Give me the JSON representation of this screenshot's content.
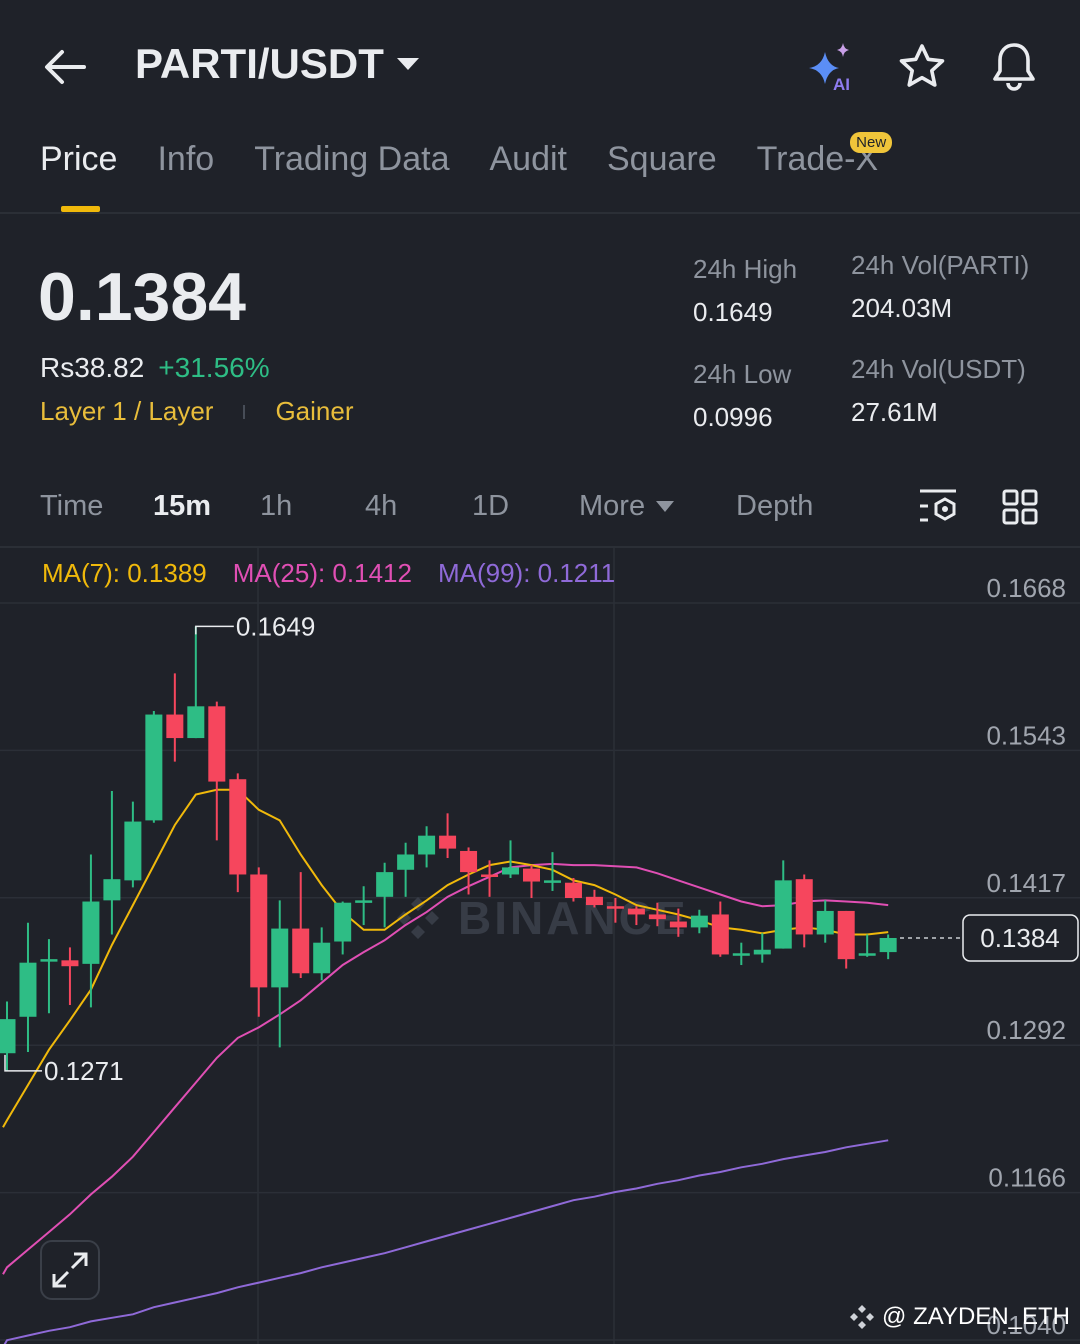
{
  "header": {
    "title": "PARTI/USDT",
    "icons": [
      "back-arrow-icon",
      "caret-down-icon",
      "ai-sparkle-icon",
      "star-icon",
      "bell-icon"
    ],
    "ai_label": "AI"
  },
  "tabs": [
    {
      "label": "Price",
      "active": true
    },
    {
      "label": "Info"
    },
    {
      "label": "Trading Data"
    },
    {
      "label": "Audit"
    },
    {
      "label": "Square"
    },
    {
      "label": "Trade-X",
      "badge": "New"
    }
  ],
  "ticker": {
    "price": "0.1384",
    "fiat": "Rs38.82",
    "change": "+31.56%",
    "tag1": "Layer 1 / Layer",
    "tag2": "Gainer"
  },
  "stats": {
    "high_label": "24h High",
    "high": "0.1649",
    "low_label": "24h Low",
    "low": "0.0996",
    "vol_base_label": "24h Vol(PARTI)",
    "vol_base": "204.03M",
    "vol_quote_label": "24h Vol(USDT)",
    "vol_quote": "27.61M"
  },
  "timeframes": {
    "time": "Time",
    "m15": "15m",
    "h1": "1h",
    "h4": "4h",
    "d1": "1D",
    "more": "More",
    "depth": "Depth",
    "selected": "15m"
  },
  "ma_legend": {
    "ma7": "MA(7): 0.1389",
    "ma25": "MA(25): 0.1412",
    "ma99": "MA(99): 0.1211"
  },
  "watermark": {
    "chart": "BINANCE",
    "user": "@ ZAYDEN_ETH"
  },
  "colors": {
    "up": "#2ebd85",
    "down": "#f6465d",
    "ma7": "#f0b90b",
    "ma25": "#e04fb4",
    "ma99": "#8f6ad8",
    "accent": "#f0b90b"
  },
  "chart_data": {
    "type": "candlestick",
    "interval": "15m",
    "y_ticks": [
      "0.1668",
      "0.1543",
      "0.1417",
      "0.1292",
      "0.1166",
      "0.1040"
    ],
    "ylim": [
      0.104,
      0.1668
    ],
    "high_marker": "0.1649",
    "low_marker": "0.1271",
    "last_price": "0.1384",
    "grid": true,
    "candles": [
      [
        0.1286,
        0.133,
        0.1271,
        0.1315
      ],
      [
        0.1317,
        0.1397,
        0.1287,
        0.1363
      ],
      [
        0.1364,
        0.1383,
        0.132,
        0.1366
      ],
      [
        0.1365,
        0.1376,
        0.1327,
        0.136
      ],
      [
        0.1362,
        0.1455,
        0.1325,
        0.1415
      ],
      [
        0.1416,
        0.1509,
        0.1387,
        0.1434
      ],
      [
        0.1433,
        0.15,
        0.1427,
        0.1483
      ],
      [
        0.1484,
        0.1577,
        0.1482,
        0.1574
      ],
      [
        0.1574,
        0.1609,
        0.1534,
        0.1554
      ],
      [
        0.1554,
        0.1649,
        0.1554,
        0.1581
      ],
      [
        0.1581,
        0.1585,
        0.1467,
        0.1517
      ],
      [
        0.1519,
        0.1524,
        0.1423,
        0.1438
      ],
      [
        0.1438,
        0.1444,
        0.1317,
        0.1342
      ],
      [
        0.1342,
        0.1416,
        0.1291,
        0.1392
      ],
      [
        0.1392,
        0.144,
        0.135,
        0.1354
      ],
      [
        0.1354,
        0.1393,
        0.1348,
        0.138
      ],
      [
        0.1381,
        0.1415,
        0.137,
        0.1414
      ],
      [
        0.1414,
        0.1428,
        0.1395,
        0.1416
      ],
      [
        0.1419,
        0.1448,
        0.1393,
        0.144
      ],
      [
        0.1442,
        0.1465,
        0.1419,
        0.1455
      ],
      [
        0.1455,
        0.1479,
        0.1444,
        0.1471
      ],
      [
        0.1471,
        0.149,
        0.1452,
        0.146
      ],
      [
        0.1458,
        0.1461,
        0.1421,
        0.144
      ],
      [
        0.1438,
        0.145,
        0.1419,
        0.1437
      ],
      [
        0.1438,
        0.1467,
        0.1435,
        0.1444
      ],
      [
        0.1443,
        0.1446,
        0.1418,
        0.1432
      ],
      [
        0.1432,
        0.1457,
        0.1424,
        0.1433
      ],
      [
        0.1431,
        0.1435,
        0.1415,
        0.1418
      ],
      [
        0.1419,
        0.1425,
        0.141,
        0.1412
      ],
      [
        0.1411,
        0.1418,
        0.1397,
        0.141
      ],
      [
        0.1409,
        0.1411,
        0.1395,
        0.1404
      ],
      [
        0.1404,
        0.1414,
        0.1394,
        0.14
      ],
      [
        0.1398,
        0.1409,
        0.1385,
        0.1393
      ],
      [
        0.1393,
        0.1408,
        0.1388,
        0.1403
      ],
      [
        0.1404,
        0.1415,
        0.1368,
        0.137
      ],
      [
        0.137,
        0.138,
        0.1361,
        0.1371
      ],
      [
        0.137,
        0.1388,
        0.1363,
        0.1374
      ],
      [
        0.1375,
        0.145,
        0.1375,
        0.1433
      ],
      [
        0.1434,
        0.1438,
        0.1376,
        0.1387
      ],
      [
        0.1387,
        0.1416,
        0.138,
        0.1407
      ],
      [
        0.1407,
        0.1407,
        0.1358,
        0.1366
      ],
      [
        0.137,
        0.1387,
        0.1368,
        0.1371
      ],
      [
        0.1372,
        0.1387,
        0.1366,
        0.1384
      ]
    ],
    "candle_format": [
      "open",
      "high",
      "low",
      "close"
    ],
    "ma7": [
      0.1229,
      0.1259,
      0.1289,
      0.1314,
      0.134,
      0.1378,
      0.1412,
      0.1446,
      0.148,
      0.1506,
      0.151,
      0.151,
      0.1493,
      0.1484,
      0.1455,
      0.1429,
      0.1406,
      0.1391,
      0.1391,
      0.1404,
      0.1416,
      0.1429,
      0.1438,
      0.1446,
      0.1449,
      0.1446,
      0.1442,
      0.1433,
      0.1429,
      0.1421,
      0.1412,
      0.1408,
      0.1404,
      0.1399,
      0.1393,
      0.1391,
      0.1388,
      0.1391,
      0.1393,
      0.1391,
      0.1387,
      0.1387,
      0.1389
    ],
    "ma25": [
      0.1104,
      0.1119,
      0.1134,
      0.1149,
      0.1166,
      0.1181,
      0.1198,
      0.1219,
      0.124,
      0.1261,
      0.1282,
      0.1299,
      0.1308,
      0.1319,
      0.1331,
      0.1346,
      0.1361,
      0.1372,
      0.1382,
      0.1395,
      0.1406,
      0.1419,
      0.1428,
      0.1436,
      0.1444,
      0.1446,
      0.1447,
      0.1446,
      0.1446,
      0.1445,
      0.1444,
      0.1439,
      0.1433,
      0.1427,
      0.1421,
      0.1415,
      0.1411,
      0.1412,
      0.1415,
      0.1416,
      0.1415,
      0.1414,
      0.1412
    ],
    "ma99": [
      0.1042,
      0.1046,
      0.105,
      0.1053,
      0.1058,
      0.1061,
      0.1064,
      0.107,
      0.1074,
      0.1078,
      0.1082,
      0.1087,
      0.1091,
      0.1095,
      0.1099,
      0.1104,
      0.1108,
      0.1112,
      0.1116,
      0.1121,
      0.1126,
      0.1131,
      0.1136,
      0.1141,
      0.1146,
      0.1151,
      0.1156,
      0.1161,
      0.1164,
      0.1168,
      0.1171,
      0.1175,
      0.1178,
      0.1182,
      0.1185,
      0.1189,
      0.1192,
      0.1196,
      0.1199,
      0.1202,
      0.1206,
      0.1209,
      0.1212
    ]
  }
}
